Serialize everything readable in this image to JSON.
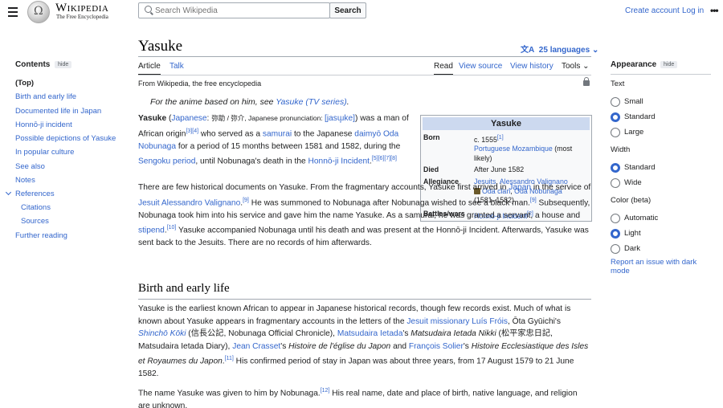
{
  "header": {
    "logo_wordmark": "Wikipedia",
    "logo_tagline": "The Free Encyclopedia",
    "search_placeholder": "Search Wikipedia",
    "search_button": "Search",
    "create_account": "Create account",
    "log_in": "Log in",
    "more": "•••"
  },
  "page": {
    "title": "Yasuke",
    "languages": "25 languages",
    "tabs": {
      "article": "Article",
      "talk": "Talk",
      "read": "Read",
      "view_source": "View source",
      "view_history": "View history",
      "tools": "Tools"
    },
    "from": "From Wikipedia, the free encyclopedia"
  },
  "toc": {
    "heading": "Contents",
    "hide": "hide",
    "items": [
      "(Top)",
      "Birth and early life",
      "Documented life in Japan",
      "Honnō-ji incident",
      "Possible depictions of Yasuke",
      "In popular culture",
      "See also",
      "Notes",
      "References",
      "Citations",
      "Sources",
      "Further reading"
    ]
  },
  "hatnote": {
    "prefix": "For the anime based on him, see ",
    "link": "Yasuke (TV series)",
    "suffix": "."
  },
  "intro": {
    "p1_name": "Yasuke",
    "p1_lang_link": "Japanese",
    "p1_kanji": "弥助 / 弥介",
    "p1_pron_label": ", Japanese pronunciation: ",
    "p1_pron": "[jasɯ̥ke]",
    "p1_t1": ") was a man of African origin",
    "p1_refs1": "[3][4]",
    "p1_t2": " who served as a ",
    "p1_samurai": "samurai",
    "p1_t3": " to the Japanese ",
    "p1_daimyo": "daimyō Oda Nobunaga",
    "p1_t4": " for a period of 15 months between 1581 and 1582, during the ",
    "p1_sengoku": "Sengoku period",
    "p1_t5": ", until Nobunaga's death in the ",
    "p1_honnoji": "Honnō-ji Incident",
    "p1_refs2": "[5][6][7][8]",
    "p2_t1": "There are few historical documents on Yasuke. From the fragmentary accounts, Yasuke first arrived in ",
    "p2_japan": "Japan",
    "p2_t2": " in the service of ",
    "p2_jesuit": "Jesuit Alessandro Valignano",
    "p2_ref9a": "[9]",
    "p2_t3": " He was summoned to Nobunaga after Nobunaga wished to see a black man.",
    "p2_ref9b": "[9]",
    "p2_t4": " Subsequently, Nobunaga took him into his service and gave him the name Yasuke. As a samurai, he was granted a servant, a house and ",
    "p2_stipend": "stipend",
    "p2_ref10": "[10]",
    "p2_t5": " Yasuke accompanied Nobunaga until his death and was present at the Honnō-ji Incident. Afterwards, Yasuke was sent back to the Jesuits. There are no records of him afterwards."
  },
  "infobox": {
    "title": "Yasuke",
    "born_label": "Born",
    "born_date": "c. 1555",
    "born_ref": "[1]",
    "born_place": "Portuguese Mozambique",
    "born_note": " (most likely)",
    "died_label": "Died",
    "died_value": "After June 1582",
    "allegiance_label": "Allegiance",
    "allegiance_1": "Jesuits",
    "allegiance_2": "Alessandro Valignano",
    "allegiance_3": "Oda clan",
    "allegiance_4": "Oda Nobunaga",
    "allegiance_years": "(1581–1582)",
    "battles_label": "Battles/wars",
    "battles_value": "Honnō-ji Incident",
    "battles_ref": "[2]"
  },
  "section": {
    "heading": "Birth and early life",
    "p1_t1": "Yasuke is the earliest known African to appear in Japanese historical records, though few records exist. Much of what is known about Yasuke appears in fragmentary accounts in the letters of the ",
    "p1_frois": "Jesuit missionary Luís Fróis",
    "p1_t2": ", Ōta Gyūichi's ",
    "p1_shincho": "Shinchō Kōki",
    "p1_t3": " (信長公記, Nobunaga Official Chronicle), ",
    "p1_matsudaira": "Matsudaira Ietada",
    "p1_t4": "'s ",
    "p1_nikki": "Matsudaira Ietada Nikki",
    "p1_t5": " (松平家忠日記, Matsudaira Ietada Diary), ",
    "p1_crasset": "Jean Crasset",
    "p1_t6": "'s ",
    "p1_histoire1": "Histoire de l'église du Japon",
    "p1_t7": " and ",
    "p1_solier": "François Solier",
    "p1_t8": "'s ",
    "p1_histoire2": "Histoire Ecclesiastique des Isles et Royaumes du Japon",
    "p1_ref11": "[11]",
    "p1_t9": " His confirmed period of stay in Japan was about three years, from 17 August 1579 to 21 June 1582.",
    "p2_t1": "The name Yasuke was given to him by Nobunaga.",
    "p2_ref12": "[12]",
    "p2_t2": " His real name, date and place of birth, native language, and religion are unknown."
  },
  "appearance": {
    "heading": "Appearance",
    "hide": "hide",
    "text_label": "Text",
    "text_options": [
      "Small",
      "Standard",
      "Large"
    ],
    "text_selected": "Standard",
    "width_label": "Width",
    "width_options": [
      "Standard",
      "Wide"
    ],
    "width_selected": "Standard",
    "color_label": "Color (beta)",
    "color_options": [
      "Automatic",
      "Light",
      "Dark"
    ],
    "color_selected": "Light",
    "report": "Report an issue with dark mode"
  }
}
